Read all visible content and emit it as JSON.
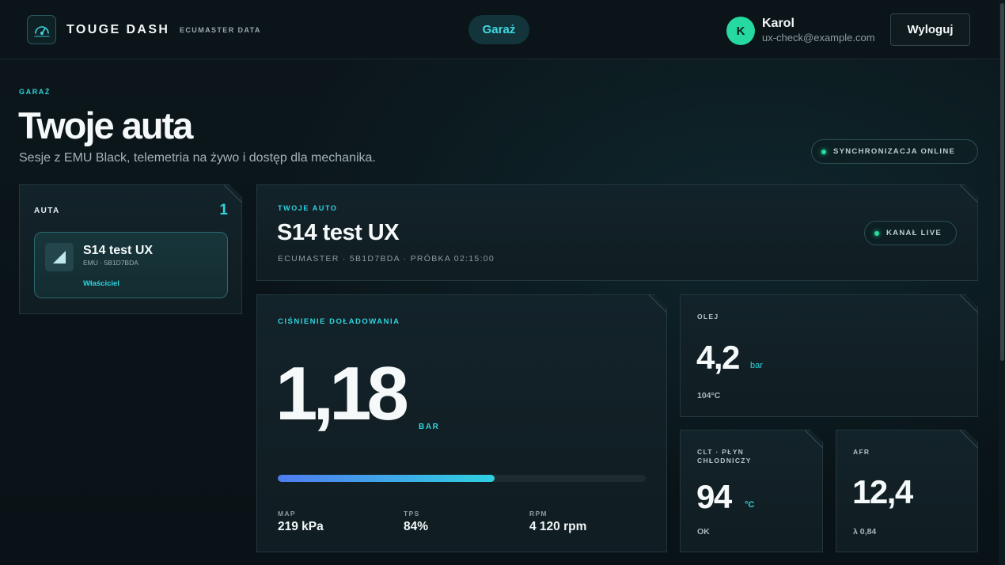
{
  "header": {
    "brand": "TOUGE DASH",
    "brand_sub": "ECUMASTER DATA",
    "nav_garage": "Garaż",
    "user": {
      "initial": "K",
      "name": "Karol",
      "email": "ux-check@example.com"
    },
    "logout_label": "Wyloguj"
  },
  "page": {
    "eyebrow": "GARAŻ",
    "title": "Twoje auta",
    "subtitle": "Sesje z EMU Black, telemetria na żywo i dostęp dla mechanika.",
    "sync_pill": "SYNCHRONIZACJA ONLINE"
  },
  "cars_panel": {
    "label": "AUTA",
    "count": "1",
    "items": [
      {
        "name": "S14 test UX",
        "meta": "EMU · 5B1D7BDA",
        "role": "Właściciel"
      }
    ]
  },
  "auto": {
    "eyebrow": "TWOJE AUTO",
    "title": "S14 test UX",
    "meta": "ECUMASTER · 5B1D7BDA · PRÓBKA 02:15:00",
    "live_pill": "KANAŁ LIVE"
  },
  "boost": {
    "label": "CIŚNIENIE DOŁADOWANIA",
    "value": "1,18",
    "unit": "BAR",
    "bar_fraction": 0.59,
    "stats": [
      {
        "key": "MAP",
        "value": "219 kPa"
      },
      {
        "key": "TPS",
        "value": "84%"
      },
      {
        "key": "RPM",
        "value": "4 120 rpm"
      }
    ]
  },
  "oil": {
    "label": "OLEJ",
    "value": "4,2",
    "unit": "bar",
    "foot": "104°C"
  },
  "clt": {
    "label": "CLT · PŁYN CHŁODNICZY",
    "value": "94",
    "unit": "°C",
    "foot": "OK"
  },
  "afr": {
    "label": "AFR",
    "value": "12,4",
    "foot": "λ 0,84"
  },
  "colors": {
    "accent": "#2fd3dd",
    "online": "#22e0a0",
    "avatar": "#26d9a0"
  }
}
